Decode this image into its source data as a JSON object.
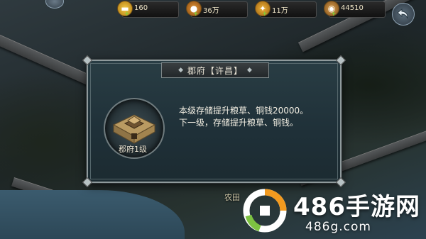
{
  "resources": [
    {
      "icon": "gold-ingot-icon",
      "value": "160"
    },
    {
      "icon": "food-icon",
      "value": "36万"
    },
    {
      "icon": "wheat-icon",
      "value": "11万"
    },
    {
      "icon": "copper-coin-icon",
      "value": "44510"
    }
  ],
  "add_symbol": "+",
  "back_button": {
    "icon": "back-arrow-icon"
  },
  "map": {
    "field_label": "农田"
  },
  "dialog": {
    "title": "郡府【许昌】",
    "building_level": "郡府1级",
    "description_line1": "本级存储提升粮草、铜钱20000。",
    "description_line2": "下一级，存储提升粮草、铜钱。"
  },
  "watermark": {
    "main": "486手游网",
    "sub": "486g.com"
  },
  "colors": {
    "accent_green": "#7fd23a",
    "panel_border": "#8f9a9c",
    "text_light": "#f2eee2"
  }
}
